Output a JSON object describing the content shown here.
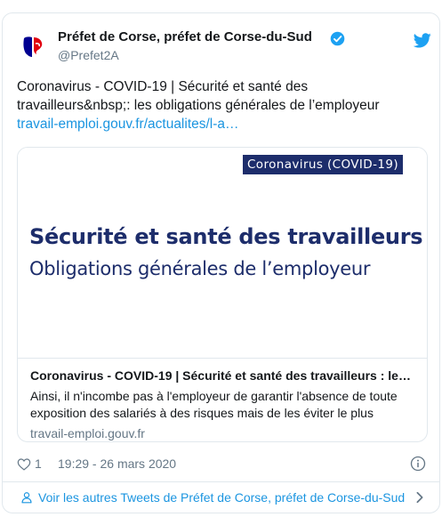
{
  "tweet": {
    "author_name": "Préfet de Corse, préfet de Corse-du-Sud",
    "handle": "@Prefet2A",
    "text_line1": "Coronavirus - COVID-19 | Sécurité et santé des",
    "text_line2": "travailleurs&nbsp;:  les obligations générales de l’employeur",
    "link_text": "travail-emploi.gouv.fr/actualites/l-a…",
    "likes": "1",
    "timestamp": "19:29 - 26 mars 2020"
  },
  "card": {
    "image_badge": "Coronavirus (COVID-19)",
    "image_title": "Sécurité et santé des travailleurs",
    "image_subtitle": "Obligations générales de l’employeur",
    "title": "Coronavirus - COVID-19 | Sécurité et santé des travailleurs : le…",
    "desc_line1": "Ainsi, il n'incombe pas à l'employeur de garantir l'absence de toute",
    "desc_line2": "exposition des salariés à des risques mais de les éviter le plus",
    "domain": "travail-emploi.gouv.fr"
  },
  "footer": {
    "text": "Voir les autres Tweets de Préfet de Corse, préfet de Corse-du-Sud"
  },
  "icons": {
    "avatar": "marianne-logo-icon",
    "verified": "verified-badge-icon",
    "twitter": "twitter-bird-icon",
    "like": "heart-icon",
    "info": "info-icon",
    "person": "person-icon",
    "chevron": "chevron-right-icon"
  },
  "colors": {
    "link": "#1b95e0",
    "verified": "#1da1f2",
    "secondary_text": "#657786",
    "border": "#e1e8ed",
    "image_navy": "#1d2d6b",
    "marianne_red": "#e1000f",
    "marianne_blue": "#000091"
  }
}
